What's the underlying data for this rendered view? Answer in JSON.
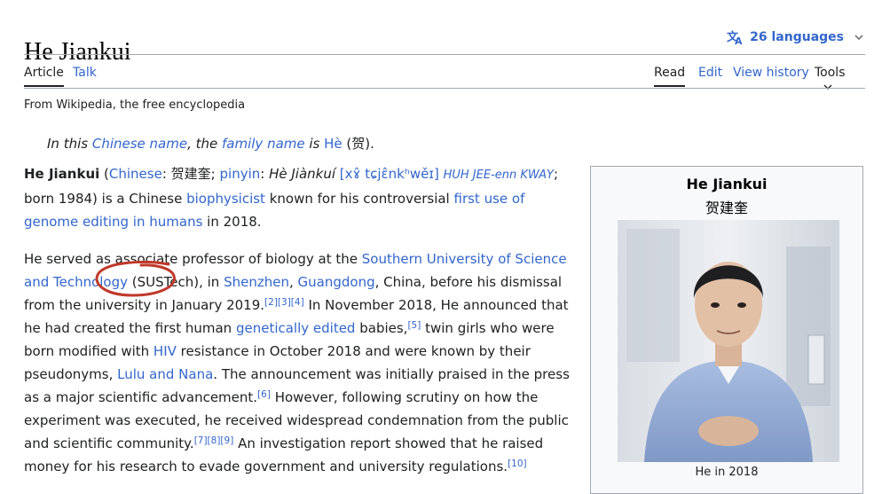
{
  "page": {
    "title": "He Jiankui",
    "languages_label": "26 languages",
    "tagline": "From Wikipedia, the free encyclopedia"
  },
  "tabs": {
    "article": "Article",
    "talk": "Talk",
    "read": "Read",
    "edit": "Edit",
    "view_history": "View history",
    "tools": "Tools"
  },
  "hatnote": {
    "pre": "In this ",
    "link1": "Chinese name",
    "mid": ", the ",
    "link2": "family name",
    "mid2": " is ",
    "link3": "Hè",
    "post": " (贺)."
  },
  "lead": {
    "name": "He Jiankui",
    "open_paren": " (",
    "chinese_link": "Chinese",
    "chinese_text": ": 贺建奎; ",
    "pinyin_link": "pinyin",
    "pinyin_colon": ": ",
    "pinyin_text": "Hè Jiànkuí",
    "ipa": "[xɤ̂ tɕjɛ̂nkʰwěɪ]",
    "respell": "HUH JEE-enn KWAY",
    "after_respell": ";",
    "born": " born 1984) is a Chinese ",
    "biophysicist": "biophysicist",
    "known": " known for his controversial ",
    "first_use": "first use of genome editing in humans",
    "in2018": " in 2018."
  },
  "para2": {
    "t1": "He served as associate professor of biology at the ",
    "sustech_link": "Southern University of Science and Technology",
    "t2": " (SUSTech), in ",
    "shenzhen": "Shenzhen",
    "comma": ", ",
    "guangdong": "Guangdong",
    "t3": ", China, before his dismissal from the university in January 2019.",
    "ref1": "[2][3][4]",
    "t4": " In November 2018, He announced that he had created the first human ",
    "gene_link": "genetically edited",
    "t5": " babies,",
    "ref2": "[5]",
    "t6": " twin girls who were born modified with ",
    "hiv": "HIV",
    "t7": " resistance in October 2018 and were known by their pseudonyms, ",
    "lulu": "Lulu and Nana",
    "t8": ". The announcement was initially praised in the press as a major scientific advancement.",
    "ref3": "[6]",
    "t9": " However, following scrutiny on how the experiment was executed, he received widespread condemnation from the public and scientific community.",
    "ref4": "[7][8][9]",
    "t10": " An investigation report showed that he raised money for his research to evade government and university regulations.",
    "ref5": "[10]"
  },
  "infobox": {
    "name": "He Jiankui",
    "native_name": "贺建奎",
    "caption": "He in 2018"
  },
  "colors": {
    "link": "#3366cc",
    "text": "#202122",
    "annotation": "#c0392b",
    "border": "#a2a9b1"
  }
}
